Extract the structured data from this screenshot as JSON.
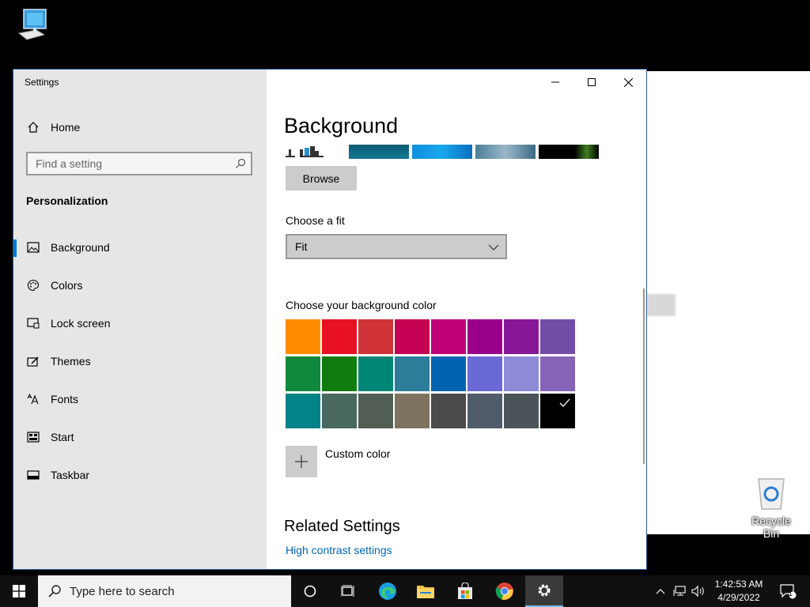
{
  "desktop": {
    "icons": [
      {
        "label": "My Computer"
      },
      {
        "label": "Recycle Bin"
      }
    ]
  },
  "window": {
    "title": "Settings",
    "controls": [
      "minimize",
      "maximize",
      "close"
    ]
  },
  "sidebar": {
    "home_label": "Home",
    "search_placeholder": "Find a setting",
    "section_title": "Personalization",
    "items": [
      {
        "label": "Background",
        "icon": "picture-icon",
        "active": true
      },
      {
        "label": "Colors",
        "icon": "palette-icon"
      },
      {
        "label": "Lock screen",
        "icon": "lock-screen-icon"
      },
      {
        "label": "Themes",
        "icon": "themes-icon"
      },
      {
        "label": "Fonts",
        "icon": "fonts-icon"
      },
      {
        "label": "Start",
        "icon": "start-icon"
      },
      {
        "label": "Taskbar",
        "icon": "taskbar-icon"
      }
    ]
  },
  "main": {
    "page_title": "Background",
    "browse_label": "Browse",
    "fit_label": "Choose a fit",
    "fit_value": "Fit",
    "color_label": "Choose your background color",
    "colors": [
      [
        "#ff8c00",
        "#e81123",
        "#d13438",
        "#c30052",
        "#bf0077",
        "#9a0089",
        "#881798",
        "#744da9"
      ],
      [
        "#10893e",
        "#107c10",
        "#018574",
        "#2d7d9a",
        "#0063b1",
        "#6b69d6",
        "#8e8cd8",
        "#8764b8"
      ],
      [
        "#038387",
        "#486860",
        "#525e54",
        "#7e735f",
        "#4c4a48",
        "#515c6b",
        "#4a5459",
        "#000000"
      ]
    ],
    "selected_color": "#000000",
    "custom_color_label": "Custom color",
    "related_title": "Related Settings",
    "related_link": "High contrast settings"
  },
  "taskbar": {
    "search_placeholder": "Type here to search",
    "time": "1:42:53 AM",
    "date": "4/29/2022",
    "notification_count": "1"
  }
}
